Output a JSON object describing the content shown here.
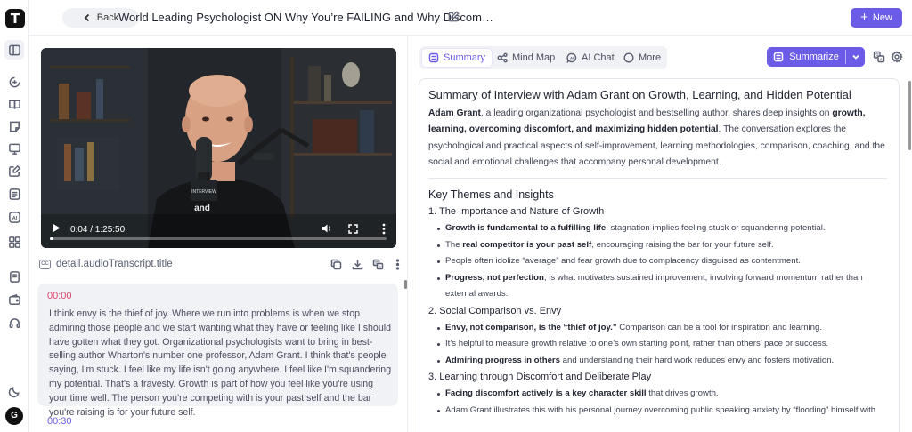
{
  "app": {
    "logo_letter": "T",
    "avatar_letter": "G"
  },
  "rail": {
    "icons": [
      "panel-toggle-icon",
      "add-document-icon",
      "book-icon",
      "sticky-note-icon",
      "slides-icon",
      "edit-note-icon",
      "document-list-icon",
      "ai-icon",
      "apps-grid-icon",
      "notebook-icon",
      "wallet-icon",
      "headset-icon",
      "moon-icon"
    ]
  },
  "topbar": {
    "back_label": "Back",
    "title": "World Leading Psychologist ON Why You’re FAILING and Why Discom…",
    "new_label": "New"
  },
  "video": {
    "time": "0:04 / 1:25:50",
    "progress": 0.01,
    "mic_text": "INTERVIEW",
    "shirt_text": "and"
  },
  "transcript": {
    "title": "detail.audioTranscript.title",
    "segments": [
      {
        "time": "00:00",
        "text": "I think envy is the thief of joy. Where we run into problems is when we stop admiring those people and we start wanting what they have or feeling like I should have gotten what they got. Organizational psychologists want to bring in best-selling author Wharton's number one professor, Adam Grant. I think that's people saying, I'm stuck. I feel like my life isn't going anywhere. I feel like I'm squandering my potential. That's a travesty. Growth is part of how you feel like you're using your time well. The person you're competing with is your past self and the bar you're raising is for your future self."
      },
      {
        "time": "00:30"
      }
    ]
  },
  "tabs": [
    {
      "label": "Summary",
      "icon": "summary-icon",
      "active": true
    },
    {
      "label": "Mind Map",
      "icon": "mind-map-icon"
    },
    {
      "label": "AI Chat",
      "icon": "ai-chat-icon"
    },
    {
      "label": "More",
      "icon": "more-circle-icon"
    }
  ],
  "summarize": {
    "label": "Summarize"
  },
  "summary": {
    "title": "Summary of Interview with Adam Grant on Growth, Learning, and Hidden Potential",
    "intro": [
      {
        "t": "Adam Grant",
        "b": true
      },
      {
        "t": ", a leading organizational psychologist and bestselling author, shares deep insights on "
      },
      {
        "t": "growth, learning, overcoming discomfort, and maximizing hidden potential",
        "b": true
      },
      {
        "t": ". The conversation explores the psychological and practical aspects of self-improvement, learning methodologies, comparison, coaching, and the social and emotional challenges that accompany personal development."
      }
    ],
    "themes_heading": "Key Themes and Insights",
    "sections": [
      {
        "heading": "1. The Importance and Nature of Growth",
        "bullets": [
          [
            {
              "t": "Growth is fundamental to a fulfilling life",
              "b": true
            },
            {
              "t": "; stagnation implies feeling stuck or squandering potential."
            }
          ],
          [
            {
              "t": "The "
            },
            {
              "t": "real competitor is your past self",
              "b": true
            },
            {
              "t": ", encouraging raising the bar for your future self."
            }
          ],
          [
            {
              "t": "People often idolize “average” and fear growth due to complacency disguised as contentment."
            }
          ],
          [
            {
              "t": "Progress, not perfection",
              "b": true
            },
            {
              "t": ", is what motivates sustained improvement, involving forward momentum rather than external awards."
            }
          ]
        ]
      },
      {
        "heading": "2. Social Comparison vs. Envy",
        "bullets": [
          [
            {
              "t": "Envy, not comparison, is the “thief of joy.”",
              "b": true
            },
            {
              "t": " Comparison can be a tool for inspiration and learning."
            }
          ],
          [
            {
              "t": "It’s helpful to measure growth relative to one’s own starting point, rather than others’ pace or success."
            }
          ],
          [
            {
              "t": "Admiring progress in others",
              "b": true
            },
            {
              "t": " and understanding their hard work reduces envy and fosters motivation."
            }
          ]
        ]
      },
      {
        "heading": "3. Learning through Discomfort and Deliberate Play",
        "bullets": [
          [
            {
              "t": "Facing discomfort actively is a key character skill",
              "b": true
            },
            {
              "t": " that drives growth."
            }
          ],
          [
            {
              "t": "Adam Grant illustrates this with his personal journey overcoming public speaking anxiety by “flooding” himself with"
            }
          ]
        ]
      }
    ]
  }
}
